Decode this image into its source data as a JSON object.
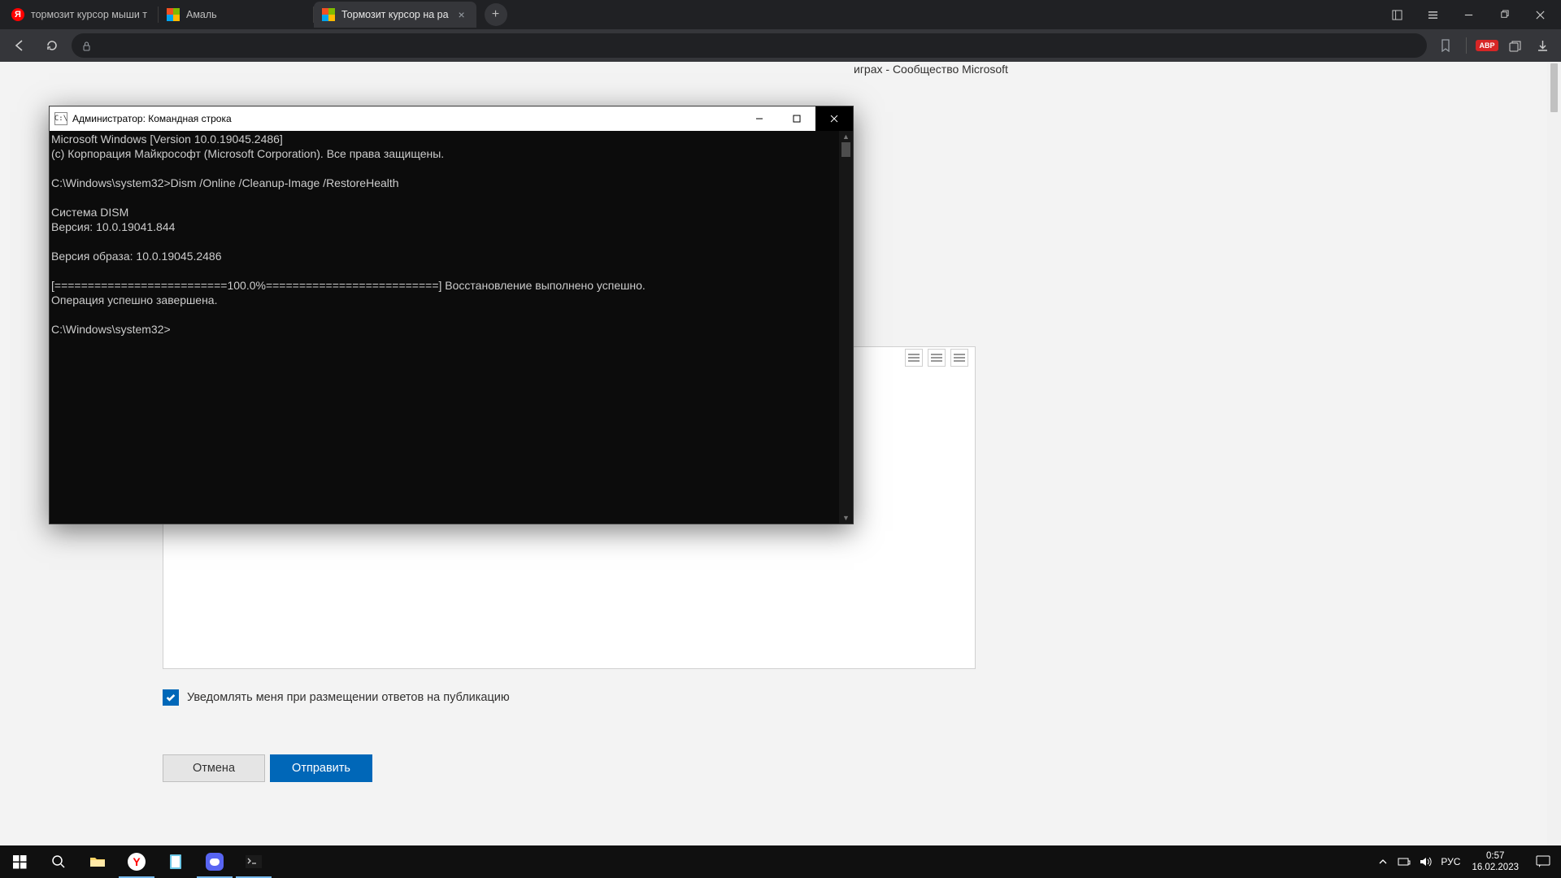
{
  "browser": {
    "tabs": [
      {
        "label": "тормозит курсор мыши т",
        "favicon": "yandex"
      },
      {
        "label": "Амаль",
        "favicon": "ms"
      },
      {
        "label": "Тормозит курсор на ра",
        "favicon": "ms",
        "active": true
      }
    ],
    "page_title_fragment": "играх - Сообщество Microsoft",
    "abp": "ABP"
  },
  "form": {
    "notify_label": "Уведомлять меня при размещении ответов на публикацию",
    "cancel": "Отмена",
    "submit": "Отправить"
  },
  "cmd": {
    "title": "Администратор: Командная строка",
    "lines": [
      "Microsoft Windows [Version 10.0.19045.2486]",
      "(c) Корпорация Майкрософт (Microsoft Corporation). Все права защищены.",
      "",
      "C:\\Windows\\system32>Dism /Online /Cleanup-Image /RestoreHealth",
      "",
      "Cистема DISM",
      "Версия: 10.0.19041.844",
      "",
      "Версия образа: 10.0.19045.2486",
      "",
      "[==========================100.0%==========================] Восстановление выполнено успешно.",
      "Операция успешно завершена.",
      "",
      "C:\\Windows\\system32>"
    ]
  },
  "tray": {
    "lang": "РУС",
    "time": "0:57",
    "date": "16.02.2023"
  }
}
